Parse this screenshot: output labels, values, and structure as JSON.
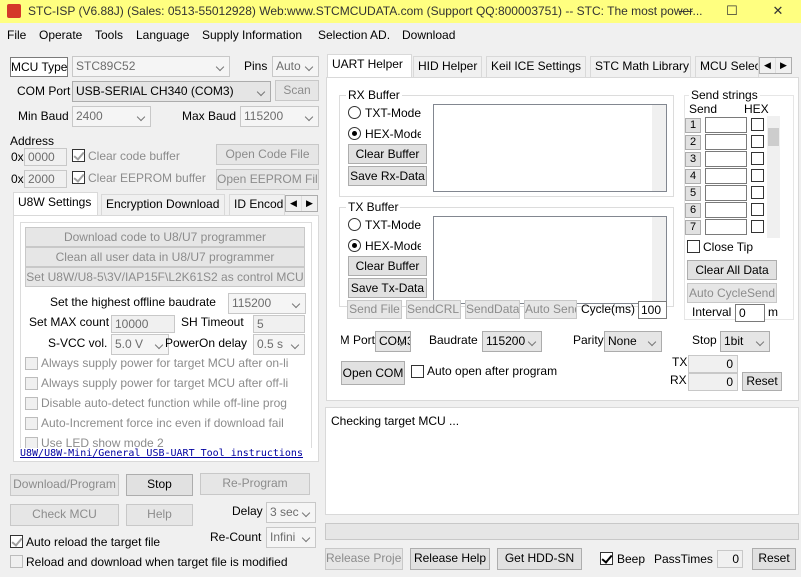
{
  "titlebar": {
    "title": "STC-ISP (V6.88J) (Sales: 0513-55012928) Web:www.STCMCUDATA.com (Support QQ:800003751) -- STC: The most power..."
  },
  "menu": [
    "File",
    "Operate",
    "Tools",
    "Language",
    "Supply Information",
    "Selection AD.",
    "Download"
  ],
  "left": {
    "mcu_type_label": "MCU Type",
    "mcu_type_value": "STC89C52",
    "pins_label": "Pins",
    "pins_value": "Auto",
    "com_port_label": "COM Port",
    "com_port_value": "USB-SERIAL CH340 (COM3)",
    "scan_label": "Scan",
    "min_baud_label": "Min Baud",
    "min_baud_value": "2400",
    "max_baud_label": "Max Baud",
    "max_baud_value": "115200",
    "address_label": "Address",
    "addr1_prefix": "0x",
    "addr1_value": "0000",
    "clear_code_label": "Clear code buffer",
    "open_code_label": "Open Code File",
    "addr2_prefix": "0x",
    "addr2_value": "2000",
    "clear_eeprom_label": "Clear EEPROM buffer",
    "open_eeprom_label": "Open EEPROM File",
    "tabs": [
      "U8W Settings",
      "Encryption Download",
      "ID Encod"
    ],
    "u8w": {
      "btn1": "Download code to U8/U7 programmer",
      "btn2": "Clean all user data in U8/U7 programmer",
      "btn3": "Set U8W/U8-5\\3V/IAP15F\\L2K61S2 as control MCU",
      "baud_label": "Set the highest offline baudrate",
      "baud_value": "115200",
      "max_count_label": "Set MAX count",
      "max_count_value": "10000",
      "sh_timeout_label": "SH Timeout",
      "sh_timeout_value": "5",
      "svcc_label": "S-VCC vol.",
      "svcc_value": "5.0 V",
      "poweron_label": "PowerOn delay",
      "poweron_value": "0.5 s",
      "opt1": "Always supply power for target MCU after on-li",
      "opt2": "Always supply power for target MCU after off-li",
      "opt3": "Disable auto-detect function while off-line prog",
      "opt4": "Auto-Increment force inc even if download fail",
      "opt5": "Use LED show mode 2",
      "link": "U8W/U8W-Mini/General USB-UART Tool instructions"
    },
    "download_btn": "Download/Program",
    "stop_btn": "Stop",
    "reprogram_btn": "Re-Program",
    "check_mcu_btn": "Check MCU",
    "help_btn": "Help",
    "delay_label": "Delay",
    "delay_value": "3 sec",
    "auto_reload_label": "Auto reload the target file",
    "recount_label": "Re-Count",
    "recount_value": "Infini",
    "reload_download_label": "Reload and download when target file is modified"
  },
  "right": {
    "tabs": [
      "UART Helper",
      "HID Helper",
      "Keil ICE Settings",
      "STC Math Library",
      "MCU Selec"
    ],
    "rx_buffer_title": "RX Buffer",
    "tx_buffer_title": "TX Buffer",
    "txt_mode": "TXT-Mode",
    "hex_mode": "HEX-Mode",
    "clear_buffer": "Clear Buffer",
    "save_rx": "Save Rx-Data",
    "save_tx": "Save Tx-Data",
    "send_file": "Send File",
    "send_crlf": "SendCRLF",
    "send_data": "SendData",
    "auto_send": "Auto Send",
    "cycle_label": "Cycle(ms)",
    "cycle_value": "100",
    "send_strings_title": "Send strings",
    "send_col": "Send",
    "hex_col": "HEX",
    "rows": [
      "1",
      "2",
      "3",
      "4",
      "5",
      "6",
      "7"
    ],
    "close_tip": "Close Tip",
    "clear_all_data": "Clear All Data",
    "auto_cycle_send": "Auto CycleSend",
    "interval_label": "Interval",
    "interval_value": "0",
    "interval_unit": "m",
    "port_label": "M Port",
    "port_value": "COM3",
    "baudrate_label": "Baudrate",
    "baudrate_value": "115200",
    "parity_label": "Parity",
    "parity_value": "None",
    "stop_label": "Stop",
    "stop_value": "1bit",
    "open_com": "Open COM",
    "auto_open_label": "Auto open after program",
    "tx_label": "TX",
    "tx_value": "0",
    "rx_label": "RX",
    "rx_value": "0",
    "reset_btn": "Reset",
    "log_text": "Checking target MCU ...",
    "release_project": "Release Project",
    "release_help": "Release Help",
    "get_hdd_sn": "Get HDD-SN",
    "beep_label": "Beep",
    "pass_times_label": "PassTimes",
    "pass_times_value": "0",
    "reset2_btn": "Reset"
  }
}
